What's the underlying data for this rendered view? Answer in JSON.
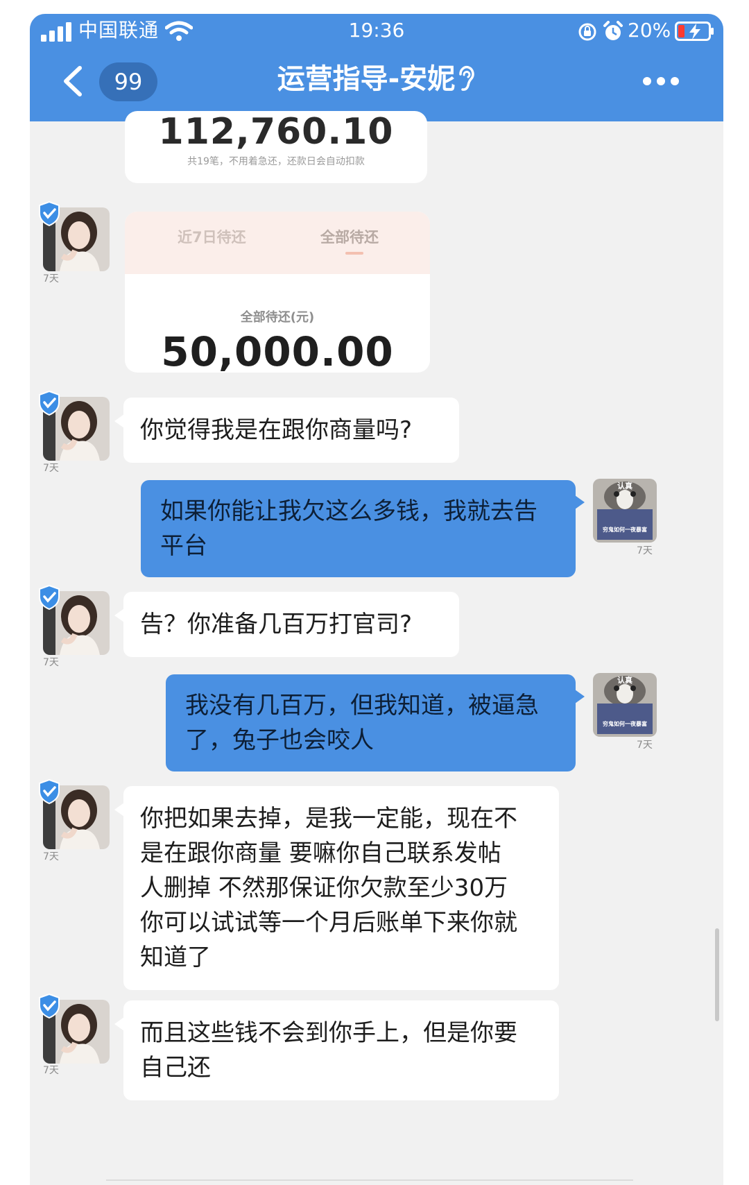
{
  "status_bar": {
    "carrier": "中国联通",
    "time": "19:36",
    "battery": "20%"
  },
  "header": {
    "unread_count": "99",
    "title": "运营指导-安妮"
  },
  "colors": {
    "header_blue": "#4a90e2",
    "outgoing_bubble": "#4a90e2",
    "incoming_bubble": "#ffffff",
    "chat_background": "#f1f1f1"
  },
  "icons": [
    "signal-icon",
    "wifi-icon",
    "orientation-lock-icon",
    "alarm-icon",
    "battery-charging-icon",
    "back-arrow-icon",
    "ear-icon",
    "more-options-icon",
    "verified-badge-icon"
  ],
  "cards": {
    "repayment_total": {
      "amount": "112,760.10",
      "note": "共19笔，不用着急还，还款日会自动扣款"
    },
    "pending": {
      "tabs": [
        "近7日待还",
        "全部待还"
      ],
      "label": "全部待还(元)",
      "amount": "50,000.00"
    }
  },
  "messages": {
    "time_label": "7天",
    "m1": "你觉得我是在跟你商量吗?",
    "m2": "如果你能让我欠这么多钱，我就去告\n平台",
    "m3": "告？你准备几百万打官司?",
    "m4": "我没有几百万，但我知道，被逼急\n了，兔子也会咬人",
    "m5": "你把如果去掉，是我一定能，现在不\n是在跟你商量 要嘛你自己联系发帖\n人删掉 不然那保证你欠款至少30万\n你可以试试等一个月后账单下来你就\n知道了",
    "m6": "而且这些钱不会到你手上，但是你要\n自己还"
  },
  "sticker": {
    "caption_top": "认真",
    "caption_bottom": "穷鬼如何一夜暴富"
  }
}
